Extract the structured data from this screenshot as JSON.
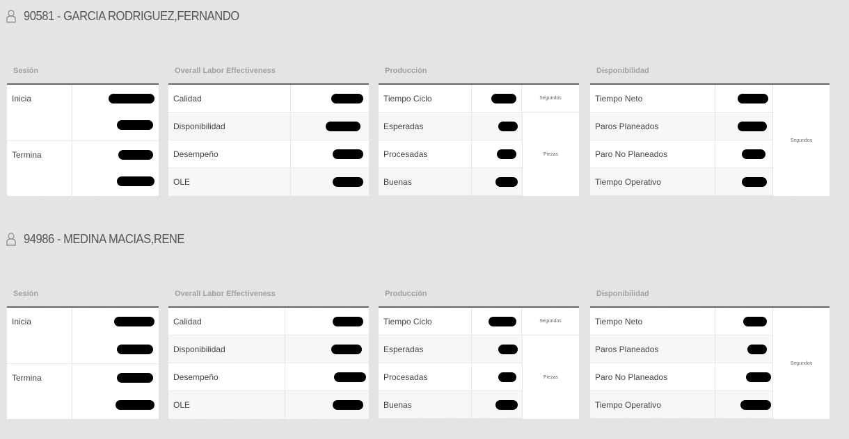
{
  "operators": [
    {
      "title": "90581 - GARCIA RODRIGUEZ,FERNANDO",
      "sesion": {
        "header": "Sesión",
        "inicia": "Inicia",
        "termina": "Termina"
      },
      "ole": {
        "header": "Overall Labor Effectiveness",
        "rows": [
          "Calidad",
          "Disponibilidad",
          "Desempeño",
          "OLE"
        ]
      },
      "produccion": {
        "header": "Producción",
        "rows": [
          "Tiempo Ciclo",
          "Esperadas",
          "Procesadas",
          "Buenas"
        ],
        "unit_ciclo": "Segundos",
        "unit_piezas": "Piezas"
      },
      "disponibilidad": {
        "header": "Disponibilidad",
        "rows": [
          "Tiempo Neto",
          "Paros Planeados",
          "Paro No Planeados",
          "Tiempo Operativo"
        ],
        "unit": "Segundos"
      }
    },
    {
      "title": "94986 - MEDINA MACIAS,RENE",
      "sesion": {
        "header": "Sesión",
        "inicia": "Inicia",
        "termina": "Termina"
      },
      "ole": {
        "header": "Overall Labor Effectiveness",
        "rows": [
          "Calidad",
          "Disponibilidad",
          "Desempeño",
          "OLE"
        ]
      },
      "produccion": {
        "header": "Producción",
        "rows": [
          "Tiempo Ciclo",
          "Esperadas",
          "Procesadas",
          "Buenas"
        ],
        "unit_ciclo": "Segundos",
        "unit_piezas": "Piezas"
      },
      "disponibilidad": {
        "header": "Disponibilidad",
        "rows": [
          "Tiempo Neto",
          "Paros Planeados",
          "Paro No Planeados",
          "Tiempo Operativo"
        ],
        "unit": "Segundos"
      }
    }
  ],
  "icons": {
    "operator": "user-icon",
    "redaction": "redaction-blob"
  },
  "colors": {
    "background": "#e3e3e3",
    "panel": "#ffffff",
    "header_text": "#a0a0a0",
    "header_rule": "#666666",
    "redaction": "#000000"
  }
}
